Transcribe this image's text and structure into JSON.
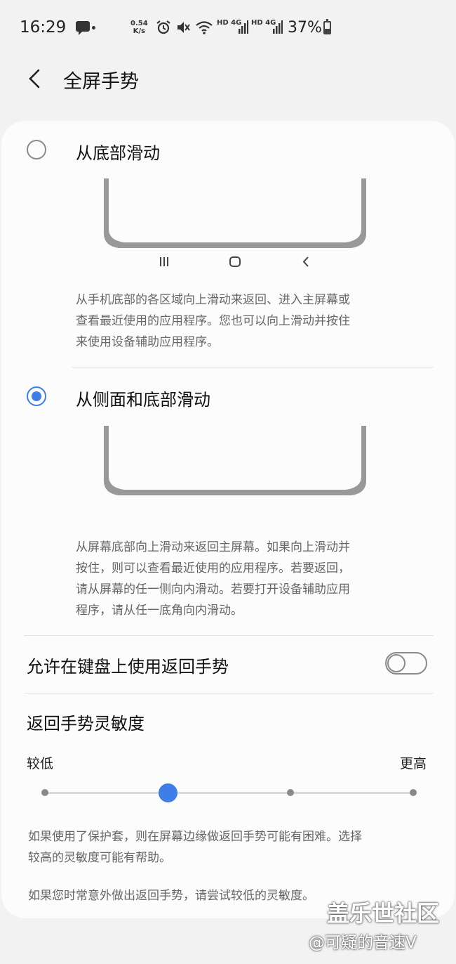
{
  "status": {
    "time": "16:29",
    "speed_value": "0.54",
    "speed_unit": "K/s",
    "net1": "HD 4G",
    "net2": "HD 4G",
    "battery": "37%",
    "battery_level": 0.37
  },
  "header": {
    "title": "全屏手势"
  },
  "options": [
    {
      "label": "从底部滑动",
      "selected": false,
      "nav_icons": [
        "recents-icon",
        "home-icon",
        "back-icon"
      ],
      "description_lines": [
        "从手机底部的各区域向上滑动来返回、进入主屏幕或",
        "查看最近使用的应用程序。您也可以向上滑动并按住",
        "来使用设备辅助应用程序。"
      ]
    },
    {
      "label": "从侧面和底部滑动",
      "selected": true,
      "description_lines": [
        "从屏幕底部向上滑动来返回主屏幕。如果向上滑动并",
        "按住，则可以查看最近使用的应用程序。若要返回，",
        "请从屏幕的任一侧向内滑动。若要打开设备辅助应用",
        "程序，请从任一底角向内滑动。"
      ]
    }
  ],
  "keyboard_gesture": {
    "label": "允许在键盘上使用返回手势",
    "enabled": false
  },
  "sensitivity": {
    "title": "返回手势灵敏度",
    "min_label": "较低",
    "max_label": "更高",
    "steps": 4,
    "value_index": 1,
    "note1_lines": [
      "如果使用了保护套，则在屏幕边缘做返回手势可能有困难。选择",
      "较高的灵敏度可能有帮助。"
    ],
    "note2": "如果您时常意外做出返回手势，请尝试较低的灵敏度。"
  },
  "watermark": {
    "line1": "盖乐世社区",
    "line2": "@可疑的音速V"
  },
  "colors": {
    "accent": "#3f7ee8",
    "illustration": "#999999"
  }
}
